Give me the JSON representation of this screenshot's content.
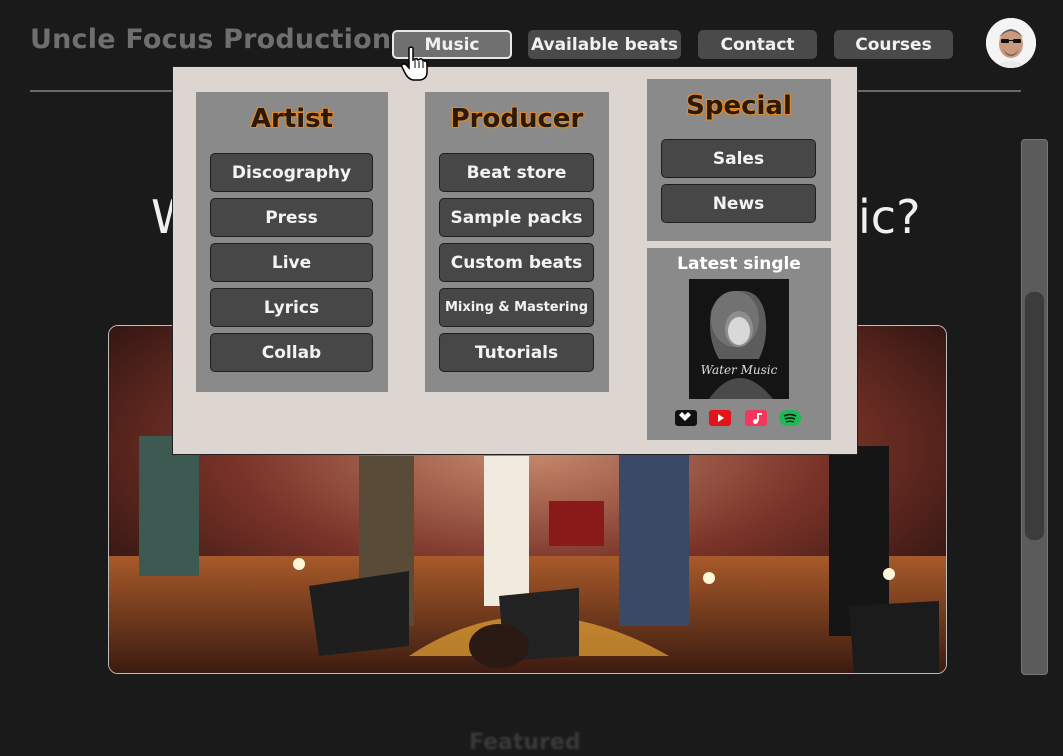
{
  "header": {
    "logo": "Uncle Focus Productions",
    "nav": [
      {
        "label": "Music",
        "active": true
      },
      {
        "label": "Available beats"
      },
      {
        "label": "Contact"
      },
      {
        "label": "Courses"
      }
    ]
  },
  "hero": {
    "text_left": "W",
    "text_right": "ic?"
  },
  "dropdown": {
    "artist": {
      "title": "Artist",
      "items": [
        "Discography",
        "Press",
        "Live",
        "Lyrics",
        "Collab"
      ]
    },
    "producer": {
      "title": "Producer",
      "items": [
        "Beat store",
        "Sample packs",
        "Custom beats",
        "Mixing & Mastering",
        "Tutorials"
      ]
    },
    "special": {
      "title": "Special",
      "items": [
        "Sales",
        "News"
      ]
    },
    "latest": {
      "title": "Latest single",
      "cover_text": "Water Music",
      "services": [
        "tidal-icon",
        "youtube-icon",
        "apple-music-icon",
        "spotify-icon"
      ]
    }
  },
  "footer": {
    "featured": "Featured"
  },
  "colors": {
    "background": "#1a1a1a",
    "menu_bg": "#ddd5d0",
    "title_outline": "#e08a2c"
  }
}
